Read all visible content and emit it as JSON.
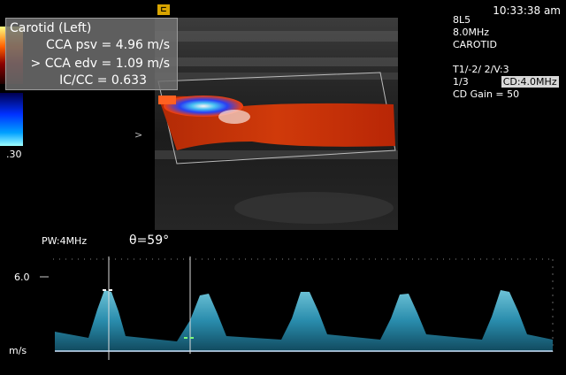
{
  "header": {
    "time": "10:33:38 am",
    "logo_glyph": "⊏"
  },
  "color_scale": {
    "bottom_label": ".30"
  },
  "measurement": {
    "title": "Carotid (Left)",
    "psv": "CCA psv = 4.96 m/s",
    "edv": "> CCA edv = 1.09 m/s",
    "ic": "IC/CC = 0.633"
  },
  "probe_info": {
    "probe": "8L5",
    "frequency": "8.0MHz",
    "preset": "CAROTID",
    "line1": "T1/-2/ 2/V:3",
    "line2_prefix": "1/3",
    "cd_box": "CD:4.0MHz",
    "cd_gain": "CD Gain =  50"
  },
  "doppler": {
    "pw_label": "PW:4MHz",
    "angle": "θ=59°",
    "scale_max": "6.0",
    "scale_unit": "m/s"
  },
  "colors": {
    "flow_red": "#c42a08",
    "spectrum": "#3fb6d2",
    "baseline": "#cfe6ff"
  },
  "markers": {
    "left_arrow": ">"
  }
}
